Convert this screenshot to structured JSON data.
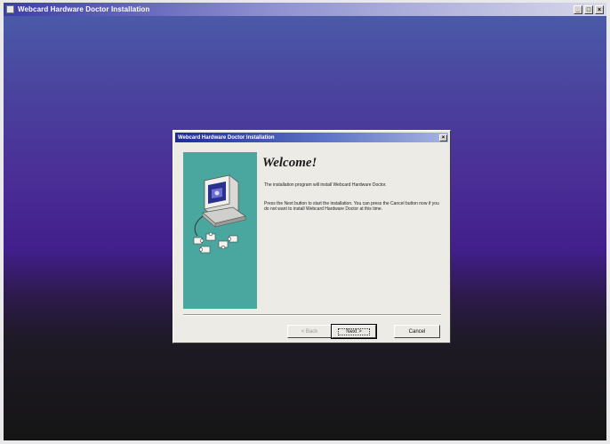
{
  "window": {
    "title": "Webcard Hardware Doctor Installation",
    "minimize_glyph": "_",
    "maximize_glyph": "□",
    "close_glyph": "×"
  },
  "dialog": {
    "title": "Webcard Hardware Doctor Installation",
    "close_glyph": "×",
    "heading": "Welcome!",
    "paragraph1": "The installation program will install Webcard Hardware Doctor.",
    "paragraph2": "Press the Next button to start the installation. You can press the Cancel button now if you do not want to install Webcard Hardware Doctor at this time.",
    "buttons": {
      "back": "< Back",
      "next": "Next >",
      "cancel": "Cancel"
    }
  },
  "icons": {
    "window_icon": "app-window-icon",
    "dialog_art": "computer-with-puzzle-pieces-icon"
  },
  "colors": {
    "side_panel": "#4aa79f",
    "desktop_top": "#4a5aa8",
    "desktop_bottom": "#151515"
  }
}
